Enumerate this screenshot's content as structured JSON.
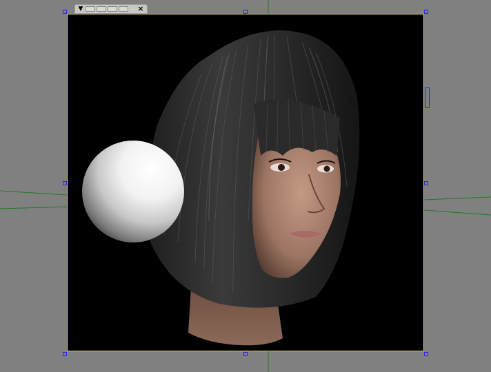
{
  "viewport": {
    "background_color": "#808080",
    "frame_border_color": "#d8d060",
    "handle_color": "#2a2ad0",
    "guide_color": "#1f7a1f"
  },
  "toolbar": {
    "menu_glyph": "▼",
    "slot_count": 4,
    "close_glyph": "×",
    "icons": [
      "dropdown-arrow-icon",
      "preset-slot-icon",
      "close-icon"
    ]
  },
  "scene": {
    "objects": [
      "white-sphere",
      "female-head-with-bob-hair"
    ],
    "render_background": "#000000",
    "sphere_color": "#ffffff"
  }
}
